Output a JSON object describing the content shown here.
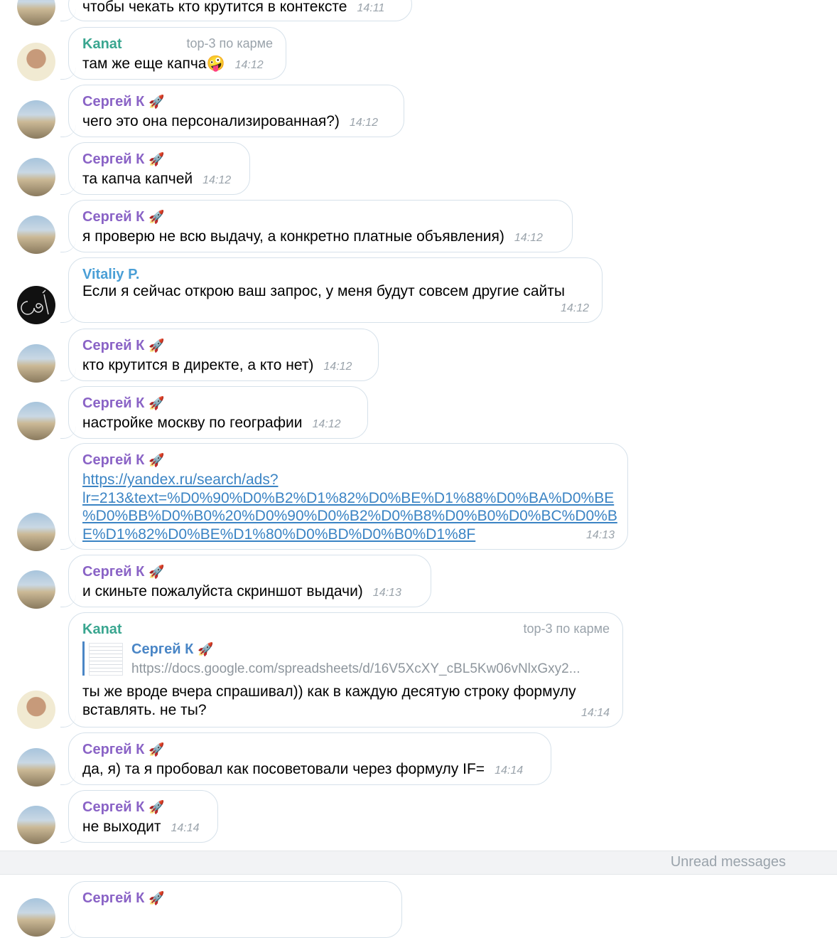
{
  "messages": [
    {
      "author": "",
      "text": "чтобы чекать кто крутится в контексте",
      "time": "14:11"
    },
    {
      "author": "Kanat",
      "role": "top-3 по карме",
      "text": "там же еще капча🤪",
      "time": "14:12"
    },
    {
      "author": "Сергей К",
      "rocket": "🚀",
      "text": "чего это она персонализированная?)",
      "time": "14:12"
    },
    {
      "author": "Сергей К",
      "rocket": "🚀",
      "text": "та капча капчей",
      "time": "14:12"
    },
    {
      "author": "Сергей К",
      "rocket": "🚀",
      "text": "я проверю не всю выдачу, а конкретно платные объявления)",
      "time": "14:12"
    },
    {
      "author": "Vitaliy P.",
      "text": "Если я сейчас открою ваш запрос, у меня будут совсем другие сайты",
      "time": "14:12"
    },
    {
      "author": "Сергей К",
      "rocket": "🚀",
      "text": "кто крутится в директе, а кто нет)",
      "time": "14:12"
    },
    {
      "author": "Сергей К",
      "rocket": "🚀",
      "text": "настройке москву по географии",
      "time": "14:12"
    },
    {
      "author": "Сергей К",
      "rocket": "🚀",
      "link_lines": [
        "https://yandex.ru/search/ads?",
        "lr=213&text=%D0%90%D0%B2%D1%82%D0%BE%D1%88%D0%BA%D0%BE",
        "%D0%BB%D0%B0%20%D0%90%D0%B2%D0%B8%D0%B0%D0%BC%D0%B",
        "E%D1%82%D0%BE%D1%80%D0%BD%D0%B0%D1%8F"
      ],
      "time": "14:13"
    },
    {
      "author": "Сергей К",
      "rocket": "🚀",
      "text": "и скиньте пожалуйста скриншот выдачи)",
      "time": "14:13"
    },
    {
      "author": "Kanat",
      "role": "top-3 по карме",
      "reply": {
        "author": "Сергей К",
        "rocket": "🚀",
        "text": "https://docs.google.com/spreadsheets/d/16V5XcXY_cBL5Kw06vNlxGxy2..."
      },
      "text_lines": [
        "ты же вроде вчера спрашивал)) как в каждую десятую строку формулу",
        "вставлять. не ты?"
      ],
      "time": "14:14"
    },
    {
      "author": "Сергей К",
      "rocket": "🚀",
      "text": "да, я) та я пробовал как посоветовали через формулу IF=",
      "time": "14:14"
    },
    {
      "author": "Сергей К",
      "rocket": "🚀",
      "text": "не выходит",
      "time": "14:14"
    },
    {
      "author": "Сергей К",
      "rocket": "🚀",
      "text": "",
      "time": ""
    }
  ],
  "divider": {
    "label": "Unread messages"
  }
}
